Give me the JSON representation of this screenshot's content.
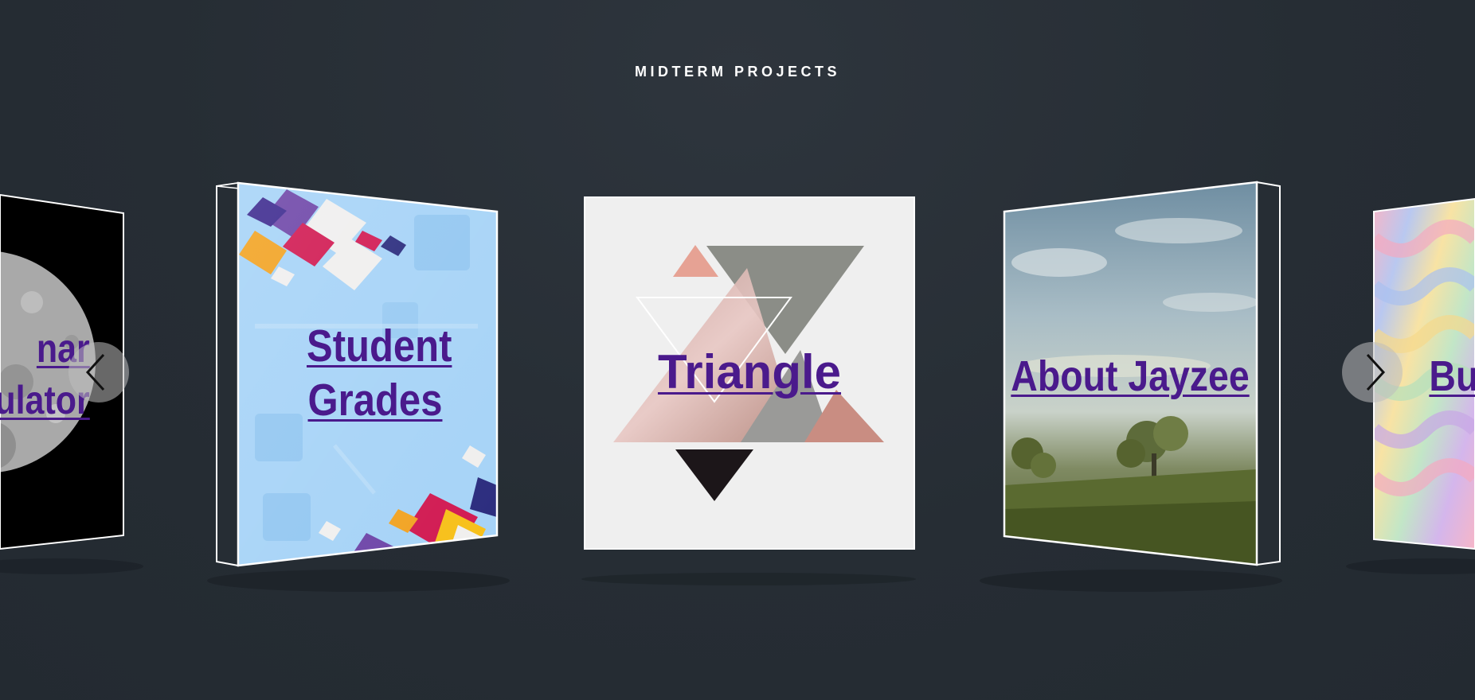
{
  "header": {
    "title": "MIDTERM PROJECTS"
  },
  "carousel": {
    "items": [
      {
        "label": "Lunar Calculator",
        "visible_text": "nar ulator",
        "line1": "nar",
        "line2": "ulator"
      },
      {
        "label": "Student Grades",
        "line1": "Student",
        "line2": "Grades"
      },
      {
        "label": "Triangle"
      },
      {
        "label": "About Jayzee"
      },
      {
        "label": "Butterfly",
        "visible_text": "But"
      }
    ],
    "prev_icon": "chevron-left-icon",
    "next_icon": "chevron-right-icon"
  },
  "colors": {
    "background": "#262d34",
    "title": "#ffffff",
    "link": "#4a1a8c",
    "card_frame": "#ffffff",
    "grades_bg": "#a6d3f7",
    "triangle_bg": "#efefef",
    "moon_bg": "#000000"
  }
}
